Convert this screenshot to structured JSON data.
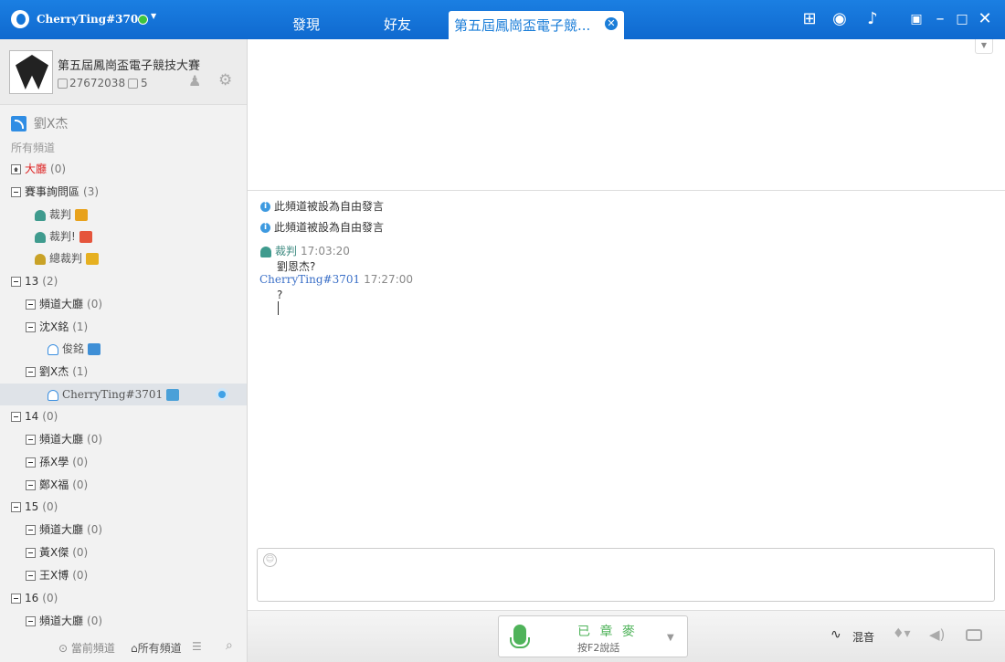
{
  "titlebar": {
    "username": "CherryTing#3701",
    "tabs": [
      "發現",
      "好友"
    ],
    "active_tab": "第五屆鳳崗盃電子競...",
    "icons": [
      "gift-icon",
      "gamepad-icon",
      "bell-icon",
      "menu-icon",
      "minimize-icon",
      "maximize-icon",
      "close-icon"
    ]
  },
  "channel": {
    "name": "第五屆鳳崗盃電子競技大賽",
    "id": "27672038",
    "members": "5"
  },
  "sidebar": {
    "current_channel": "劉X杰",
    "all_channels_label": "所有頻道",
    "tree": [
      {
        "label": "大廳",
        "count": "(0)"
      },
      {
        "label": "賽事詢問區",
        "count": "(3)"
      },
      {
        "label": "裁判"
      },
      {
        "label": "裁判!"
      },
      {
        "label": "總裁判"
      },
      {
        "label": "13",
        "count": "(2)"
      },
      {
        "label": "頻道大廳",
        "count": "(0)"
      },
      {
        "label": "沈X銘",
        "count": "(1)"
      },
      {
        "label": "俊銘"
      },
      {
        "label": "劉X杰",
        "count": "(1)"
      },
      {
        "label": "CherryTing#3701"
      },
      {
        "label": "14",
        "count": "(0)"
      },
      {
        "label": "頻道大廳",
        "count": "(0)"
      },
      {
        "label": "孫X學",
        "count": "(0)"
      },
      {
        "label": "鄭X福",
        "count": "(0)"
      },
      {
        "label": "15",
        "count": "(0)"
      },
      {
        "label": "頻道大廳",
        "count": "(0)"
      },
      {
        "label": "黃X傑",
        "count": "(0)"
      },
      {
        "label": "王X博",
        "count": "(0)"
      },
      {
        "label": "16",
        "count": "(0)"
      },
      {
        "label": "頻道大廳",
        "count": "(0)"
      }
    ],
    "bottom": {
      "current_tab": "當前頻道",
      "all_tab": "所有頻道"
    }
  },
  "chat": {
    "system_messages": [
      "此頻道被設為自由發言",
      "此頻道被設為自由發言"
    ],
    "messages": [
      {
        "sender": "裁判",
        "time": "17:03:20",
        "text": "劉恩杰?"
      },
      {
        "sender": "CherryTing#3701",
        "time": "17:27:00",
        "text": "?"
      }
    ]
  },
  "footer": {
    "mic_state": "已 章 麥",
    "mic_hint": "按F2說話",
    "mix_label": "混音"
  }
}
